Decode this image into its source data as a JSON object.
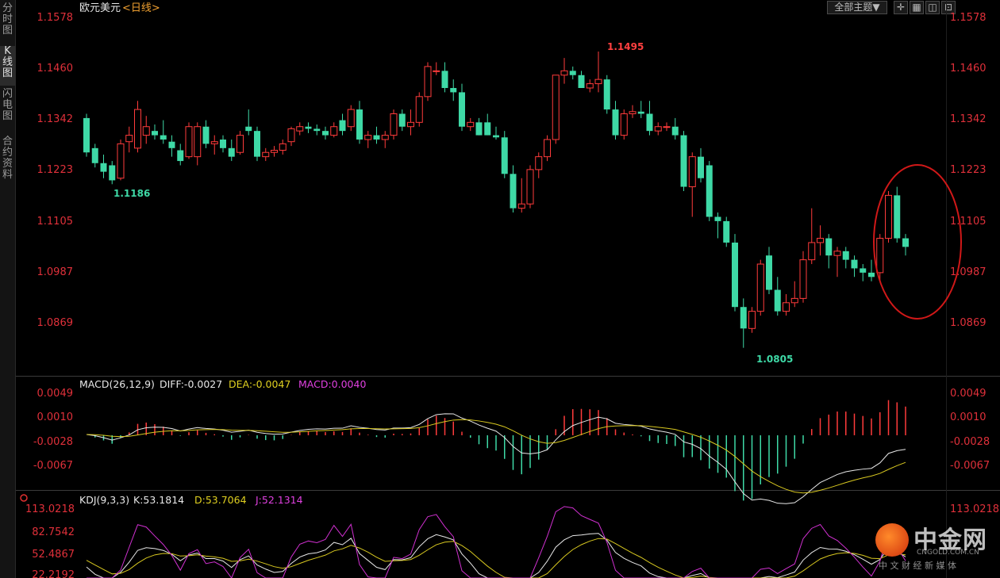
{
  "sidebar": {
    "tabs": [
      {
        "label": "分时图",
        "active": false
      },
      {
        "label": "K线图",
        "active": true
      },
      {
        "label": "闪电图",
        "active": false
      },
      {
        "label": "合约资料",
        "active": false
      }
    ]
  },
  "toolbar": {
    "theme_label": "全部主题▼",
    "icons": [
      "crosshair-icon",
      "layout-icon",
      "panel-icon",
      "expand-icon"
    ]
  },
  "main": {
    "instrument": "欧元美元",
    "period": "<日线>",
    "y_ticks": [
      "1.1578",
      "1.1460",
      "1.1342",
      "1.1223",
      "1.1105",
      "1.0987",
      "1.0869"
    ],
    "annotations": {
      "high": "1.1495",
      "low1": "1.1186",
      "low2": "1.0805"
    },
    "up_color": "#ff3b3b",
    "down_color": "#3ed9a6"
  },
  "macd": {
    "title": "MACD(26,12,9)",
    "diff_label": "DIFF:-0.0027",
    "dea_label": "DEA:-0.0047",
    "macd_label": "MACD:0.0040",
    "y_ticks": [
      "0.0049",
      "0.0010",
      "-0.0028",
      "-0.0067"
    ]
  },
  "kdj": {
    "title": "KDJ(9,3,3)",
    "k_label": "K:53.1814",
    "d_label": "D:53.7064",
    "j_label": "J:52.1314",
    "y_ticks": [
      "113.0218",
      "82.7542",
      "52.4867",
      "22.2192"
    ]
  },
  "watermark": {
    "name": "中金网",
    "domain": "CNGOLD.COM.CN",
    "slogan": "中 文 财 经 新 媒 体"
  },
  "chart_data": {
    "type": "candlestick",
    "title": "欧元美元 <日线>",
    "ylim": [
      1.076,
      1.16
    ],
    "candles": [
      [
        1.134,
        1.135,
        1.125,
        1.126
      ],
      [
        1.127,
        1.128,
        1.1225,
        1.1235
      ],
      [
        1.1235,
        1.1255,
        1.12,
        1.1215
      ],
      [
        1.123,
        1.124,
        1.1186,
        1.1195
      ],
      [
        1.12,
        1.129,
        1.1195,
        1.128
      ],
      [
        1.1285,
        1.132,
        1.126,
        1.13
      ],
      [
        1.127,
        1.138,
        1.126,
        1.136
      ],
      [
        1.13,
        1.1345,
        1.128,
        1.132
      ],
      [
        1.131,
        1.1325,
        1.129,
        1.13
      ],
      [
        1.13,
        1.1335,
        1.128,
        1.129
      ],
      [
        1.1285,
        1.13,
        1.125,
        1.127
      ],
      [
        1.1265,
        1.128,
        1.123,
        1.124
      ],
      [
        1.125,
        1.133,
        1.1245,
        1.132
      ],
      [
        1.125,
        1.133,
        1.123,
        1.132
      ],
      [
        1.132,
        1.1335,
        1.127,
        1.128
      ],
      [
        1.128,
        1.13,
        1.1255,
        1.1285
      ],
      [
        1.129,
        1.13,
        1.126,
        1.127
      ],
      [
        1.127,
        1.129,
        1.124,
        1.125
      ],
      [
        1.126,
        1.131,
        1.1255,
        1.13
      ],
      [
        1.132,
        1.136,
        1.13,
        1.131
      ],
      [
        1.131,
        1.132,
        1.124,
        1.125
      ],
      [
        1.125,
        1.127,
        1.124,
        1.126
      ],
      [
        1.126,
        1.1275,
        1.125,
        1.1265
      ],
      [
        1.1265,
        1.129,
        1.1255,
        1.128
      ],
      [
        1.1285,
        1.132,
        1.1275,
        1.1315
      ],
      [
        1.131,
        1.133,
        1.13,
        1.132
      ],
      [
        1.132,
        1.133,
        1.1305,
        1.1315
      ],
      [
        1.1315,
        1.1325,
        1.13,
        1.131
      ],
      [
        1.131,
        1.132,
        1.129,
        1.13
      ],
      [
        1.13,
        1.133,
        1.1295,
        1.132
      ],
      [
        1.1335,
        1.135,
        1.13,
        1.131
      ],
      [
        1.132,
        1.137,
        1.131,
        1.136
      ],
      [
        1.136,
        1.138,
        1.128,
        1.129
      ],
      [
        1.129,
        1.131,
        1.127,
        1.13
      ],
      [
        1.13,
        1.132,
        1.128,
        1.129
      ],
      [
        1.129,
        1.131,
        1.127,
        1.13
      ],
      [
        1.13,
        1.136,
        1.129,
        1.135
      ],
      [
        1.135,
        1.136,
        1.131,
        1.132
      ],
      [
        1.132,
        1.136,
        1.13,
        1.133
      ],
      [
        1.133,
        1.14,
        1.132,
        1.139
      ],
      [
        1.139,
        1.147,
        1.138,
        1.146
      ],
      [
        1.145,
        1.147,
        1.144,
        1.145
      ],
      [
        1.145,
        1.147,
        1.14,
        1.141
      ],
      [
        1.141,
        1.143,
        1.138,
        1.14
      ],
      [
        1.14,
        1.142,
        1.131,
        1.132
      ],
      [
        1.132,
        1.134,
        1.131,
        1.133
      ],
      [
        1.133,
        1.134,
        1.13,
        1.13
      ],
      [
        1.133,
        1.135,
        1.13,
        1.13
      ],
      [
        1.13,
        1.132,
        1.129,
        1.1295
      ],
      [
        1.1295,
        1.131,
        1.12,
        1.121
      ],
      [
        1.121,
        1.123,
        1.112,
        1.113
      ],
      [
        1.113,
        1.12,
        1.112,
        1.114
      ],
      [
        1.114,
        1.123,
        1.113,
        1.122
      ],
      [
        1.122,
        1.126,
        1.12,
        1.125
      ],
      [
        1.125,
        1.13,
        1.124,
        1.129
      ],
      [
        1.129,
        1.144,
        1.128,
        1.144
      ],
      [
        1.144,
        1.148,
        1.142,
        1.145
      ],
      [
        1.145,
        1.146,
        1.143,
        1.144
      ],
      [
        1.144,
        1.145,
        1.141,
        1.141
      ],
      [
        1.141,
        1.143,
        1.14,
        1.142
      ],
      [
        1.142,
        1.1495,
        1.14,
        1.143
      ],
      [
        1.143,
        1.144,
        1.135,
        1.136
      ],
      [
        1.136,
        1.138,
        1.129,
        1.13
      ],
      [
        1.13,
        1.136,
        1.129,
        1.135
      ],
      [
        1.135,
        1.137,
        1.134,
        1.1355
      ],
      [
        1.1355,
        1.138,
        1.134,
        1.135
      ],
      [
        1.135,
        1.138,
        1.13,
        1.131
      ],
      [
        1.131,
        1.133,
        1.13,
        1.132
      ],
      [
        1.132,
        1.133,
        1.131,
        1.132
      ],
      [
        1.132,
        1.134,
        1.129,
        1.13
      ],
      [
        1.13,
        1.131,
        1.117,
        1.118
      ],
      [
        1.118,
        1.126,
        1.111,
        1.125
      ],
      [
        1.125,
        1.127,
        1.119,
        1.12
      ],
      [
        1.123,
        1.124,
        1.11,
        1.111
      ],
      [
        1.111,
        1.112,
        1.106,
        1.11
      ],
      [
        1.11,
        1.111,
        1.104,
        1.105
      ],
      [
        1.105,
        1.107,
        1.089,
        1.09
      ],
      [
        1.09,
        1.092,
        1.0805,
        1.085
      ],
      [
        1.085,
        1.09,
        1.084,
        1.089
      ],
      [
        1.089,
        1.101,
        1.088,
        1.1
      ],
      [
        1.102,
        1.104,
        1.093,
        1.094
      ],
      [
        1.094,
        1.097,
        1.088,
        1.089
      ],
      [
        1.089,
        1.093,
        1.088,
        1.091
      ],
      [
        1.091,
        1.096,
        1.09,
        1.092
      ],
      [
        1.092,
        1.103,
        1.091,
        1.101
      ],
      [
        1.101,
        1.113,
        1.1,
        1.105
      ],
      [
        1.105,
        1.109,
        1.102,
        1.106
      ],
      [
        1.106,
        1.107,
        1.099,
        1.102
      ],
      [
        1.102,
        1.104,
        1.097,
        1.103
      ],
      [
        1.103,
        1.104,
        1.099,
        1.101
      ],
      [
        1.101,
        1.102,
        1.097,
        1.099
      ],
      [
        1.099,
        1.1,
        1.096,
        1.098
      ],
      [
        1.098,
        1.101,
        1.096,
        1.097
      ],
      [
        1.098,
        1.107,
        1.096,
        1.106
      ],
      [
        1.106,
        1.117,
        1.105,
        1.116
      ],
      [
        1.116,
        1.118,
        1.105,
        1.106
      ],
      [
        1.106,
        1.107,
        1.102,
        1.104
      ]
    ]
  }
}
